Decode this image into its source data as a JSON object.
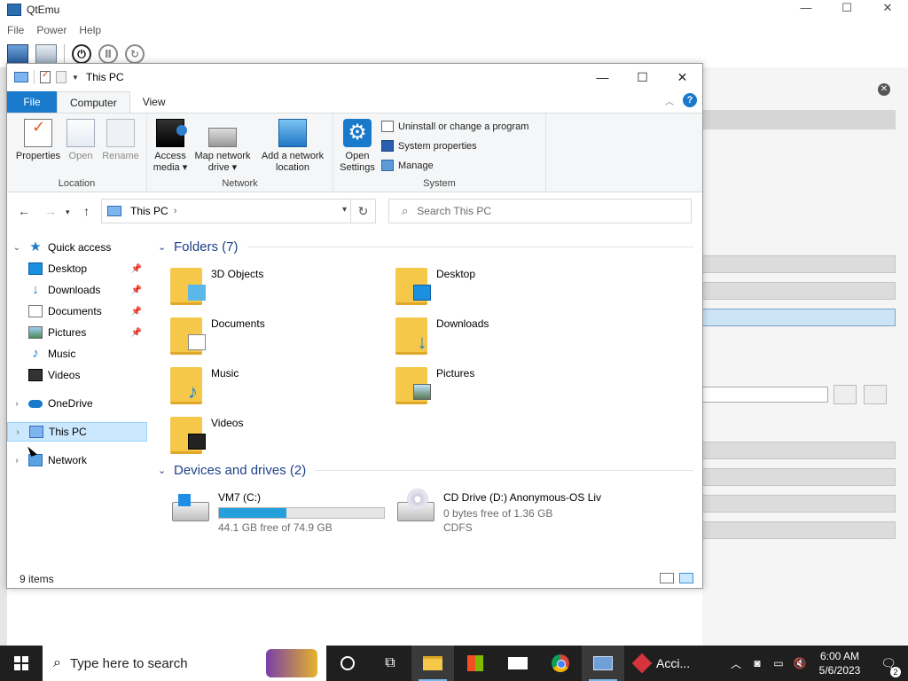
{
  "host": {
    "title": "QtEmu",
    "controls": {
      "minimize": "—",
      "maximize": "☐",
      "close": "✕"
    },
    "menu": [
      "File",
      "Power",
      "Help"
    ],
    "panel_close": "✕"
  },
  "explorer": {
    "title": "This PC",
    "window_controls": {
      "minimize": "—",
      "maximize": "☐",
      "close": "✕"
    },
    "tabs": {
      "file": "File",
      "computer": "Computer",
      "view": "View"
    },
    "help": "?",
    "ribbon": {
      "location": {
        "label": "Location",
        "properties": "Properties",
        "open": "Open",
        "rename": "Rename"
      },
      "network": {
        "label": "Network",
        "access_media": [
          "Access",
          "media ▾"
        ],
        "map_drive": [
          "Map network",
          "drive ▾"
        ],
        "add_location": [
          "Add a network",
          "location"
        ]
      },
      "system": {
        "label": "System",
        "open_settings": [
          "Open",
          "Settings"
        ],
        "uninstall": "Uninstall or change a program",
        "system_properties": "System properties",
        "manage": "Manage"
      }
    },
    "address": {
      "crumb": "This PC",
      "search_placeholder": "Search This PC"
    },
    "nav": {
      "quick_access": "Quick access",
      "items": [
        "Desktop",
        "Downloads",
        "Documents",
        "Pictures",
        "Music",
        "Videos"
      ],
      "onedrive": "OneDrive",
      "this_pc": "This PC",
      "network": "Network"
    },
    "folders_header": "Folders (7)",
    "folders": [
      "3D Objects",
      "Desktop",
      "Documents",
      "Downloads",
      "Music",
      "Pictures",
      "Videos"
    ],
    "devices_header": "Devices and drives (2)",
    "drives": [
      {
        "name": "VM7 (C:)",
        "free": "44.1 GB free of 74.9 GB",
        "used_fraction": 0.41
      },
      {
        "name": "CD Drive (D:) Anonymous-OS Liv",
        "free": "0 bytes free of 1.36 GB",
        "fs": "CDFS"
      }
    ],
    "status": "9 items"
  },
  "taskbar": {
    "search_text": "Type here to search",
    "app_label": "Acci...",
    "time": "6:00 AM",
    "date": "5/6/2023",
    "notification_count": "2"
  }
}
